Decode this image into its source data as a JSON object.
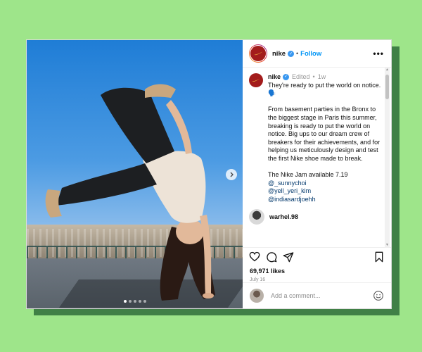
{
  "colors": {
    "background": "#9ee58a",
    "accent": "#0095f6",
    "brand": "#a31c1c",
    "verified": "#3897f0"
  },
  "header": {
    "username": "nike",
    "separator": "•",
    "follow_label": "Follow",
    "more_icon": "more-icon"
  },
  "caption": {
    "username": "nike",
    "edited": "Edited",
    "dot": "•",
    "time": "1w",
    "line1": "They're ready to put the world on notice. 🗣️",
    "para2": "From basement parties in the Bronx to the biggest stage in Paris this summer, breaking is ready to put the world on notice. Big ups to our dream crew of breakers for their achievements, and for helping us meticulously design and test the first Nike shoe made to break.",
    "para3": "The Nike Jam available 7.19",
    "mentions": [
      "@_sunnychoi",
      "@yell_yeri_kim",
      "@indiasardjoehh"
    ]
  },
  "comment": {
    "username": "warhel.98"
  },
  "carousel": {
    "slide_count": 5,
    "active_slide": 1
  },
  "stats": {
    "likes": "69,971 likes",
    "date": "July 16"
  },
  "add_comment": {
    "placeholder": "Add a comment..."
  }
}
